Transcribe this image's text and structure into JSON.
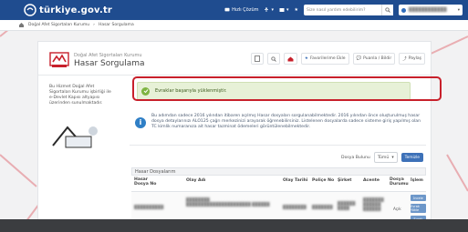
{
  "colors": {
    "topbar": "#1f4c8f",
    "accent_red": "#c8202b",
    "success_bg": "#e7f1d7",
    "info_icon": "#2f7fc6",
    "primary_btn": "#3d71b8"
  },
  "header": {
    "logo_text": "türkiye.gov.tr",
    "help_label": "Hızlı Çözüm",
    "search_placeholder": "Size nasıl yardım edebilirim?"
  },
  "breadcrumb": {
    "home_icon": "home-icon",
    "items": [
      "Doğal Afet Sigortaları Kurumu",
      "Hasar Sorgulama"
    ]
  },
  "service": {
    "subtitle": "Doğal Afet Sigortaları Kurumu",
    "title": "Hasar Sorgulama",
    "toolbar": {
      "favorites_label": "Favorilerime Ekle",
      "feedback_label": "Puanla / Bildir",
      "share_label": "Paylaş"
    }
  },
  "sidebar": {
    "text": "Bu Hizmet Doğal Afet Sigortaları Kurumu işbirliği ile e-Devlet Kapısı altyapısı üzerinden sunulmaktadır."
  },
  "alerts": {
    "success": "Evraklar başarıyla yüklenmiştir.",
    "info": "Bu adımdan sadece 2016 yılından itibaren açılmış Hasar dosyaları sorgulanabilmektedir. 2016 yılından önce oluşturulmuş hasar dosya detaylarınızı ALO125 çağrı merkezinizi arayarak öğrenebilirsiniz. Listelenen dosyalarda sadece sisteme giriş yapılmış olan TC kimlik numaranıza ait hasar tazminat ödemeleri görüntülenebilmektedir."
  },
  "download": {
    "label": "Dosya Bulunu",
    "select_value": "Tümü",
    "button_label": "Temizle"
  },
  "table": {
    "title": "Hasar Dosyalarım",
    "columns": [
      "Hasar Dosya No",
      "Olay Adı",
      "Olay Tarihi",
      "Poliçe No",
      "Şirket",
      "Acente",
      "Dosya Durumu",
      "İşlem"
    ],
    "rows": [
      {
        "status": "Açık",
        "actions": [
          "İncele",
          "Evrak Yükle",
          "Evrak"
        ]
      }
    ]
  }
}
